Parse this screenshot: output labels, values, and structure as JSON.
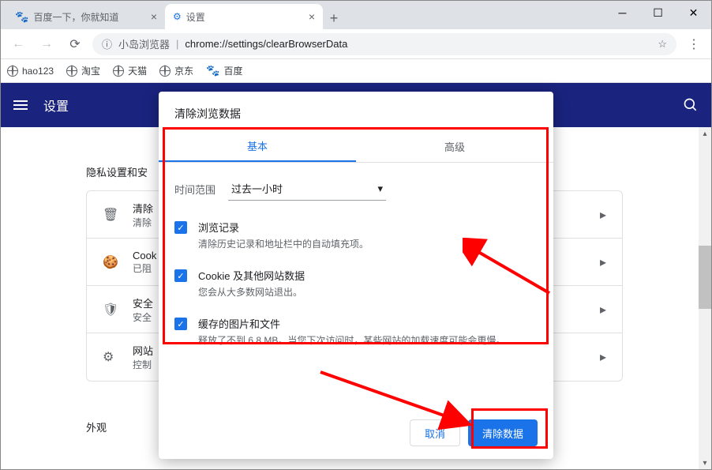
{
  "tabs": [
    {
      "title": "百度一下，你就知道"
    },
    {
      "title": "设置"
    }
  ],
  "omnibox": {
    "app": "小岛浏览器",
    "url": "chrome://settings/clearBrowserData"
  },
  "bookmarks": [
    "hao123",
    "淘宝",
    "天猫",
    "京东",
    "百度"
  ],
  "settings_header": "设置",
  "section_title": "隐私设置和安",
  "card_rows": [
    {
      "title": "清除",
      "sub": "清除"
    },
    {
      "title": "Cook",
      "sub": "已阻"
    },
    {
      "title": "安全",
      "sub": "安全"
    },
    {
      "title": "网站",
      "sub": "控制"
    }
  ],
  "appearance": "外观",
  "dialog": {
    "title": "清除浏览数据",
    "tabs": {
      "basic": "基本",
      "advanced": "高级"
    },
    "time_label": "时间范围",
    "time_value": "过去一小时",
    "items": [
      {
        "title": "浏览记录",
        "sub": "清除历史记录和地址栏中的自动填充项。"
      },
      {
        "title": "Cookie 及其他网站数据",
        "sub": "您会从大多数网站退出。"
      },
      {
        "title": "缓存的图片和文件",
        "sub": "释放了不到 6.8 MB。当您下次访问时，某些网站的加载速度可能会更慢。"
      }
    ],
    "cancel": "取消",
    "confirm": "清除数据"
  }
}
